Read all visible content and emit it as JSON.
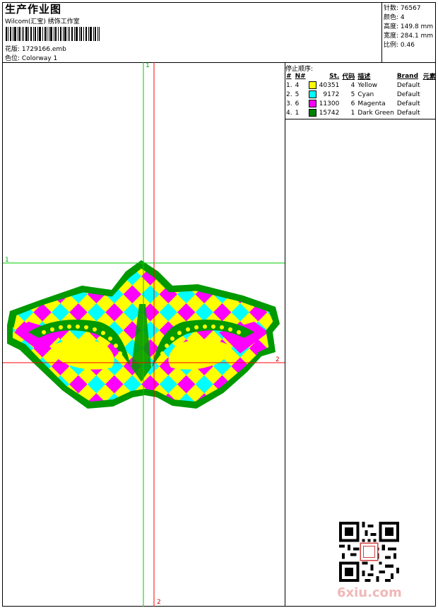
{
  "header": {
    "title": "生产作业图",
    "subtitle": "Wilcom(汇宝) 绣饰工作室",
    "design_label": "花版:",
    "design_value": "1729166.emb",
    "colorway_label": "色位:",
    "colorway_value": "Colorway 1"
  },
  "stats": {
    "stitches_label": "针数:",
    "stitches_value": "76567",
    "colors_label": "颜色:",
    "colors_value": "4",
    "height_label": "高度:",
    "height_value": "149.8 mm",
    "width_label": "宽度:",
    "width_value": "284.1 mm",
    "scale_label": "比例:",
    "scale_value": "0.46"
  },
  "stop_sequence": {
    "title": "停止顺序:",
    "columns": [
      "#",
      "N#",
      "St.",
      "代码",
      "描述",
      "Brand",
      "元素"
    ],
    "rows": [
      {
        "idx": "1.",
        "n": "4",
        "color": "#ffff00",
        "st": "40351",
        "code": "4",
        "desc": "Yellow",
        "brand": "Default"
      },
      {
        "idx": "2.",
        "n": "5",
        "color": "#00ffff",
        "st": "9172",
        "code": "5",
        "desc": "Cyan",
        "brand": "Default"
      },
      {
        "idx": "3.",
        "n": "6",
        "color": "#ff00ff",
        "st": "11300",
        "code": "6",
        "desc": "Magenta",
        "brand": "Default"
      },
      {
        "idx": "4.",
        "n": "1",
        "color": "#008000",
        "st": "15742",
        "code": "1",
        "desc": "Dark Green",
        "brand": "Default"
      }
    ]
  },
  "guides": {
    "top_label": "1",
    "left_label": "1",
    "right_label": "2",
    "bottom_label": "2"
  },
  "watermark": "6xiu.com",
  "colors": {
    "yellow": "#ffff00",
    "cyan": "#00ffff",
    "magenta": "#ff00ff",
    "green": "#009900",
    "guide_green": "#00cc00",
    "guide_red": "#ff0000"
  }
}
